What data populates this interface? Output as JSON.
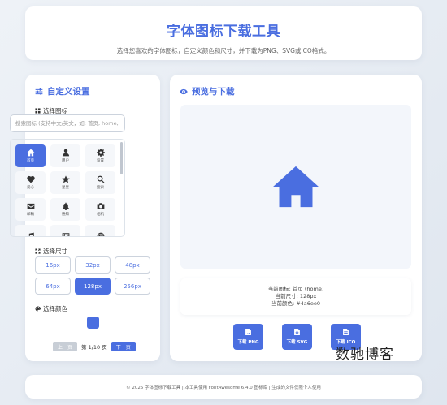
{
  "header": {
    "title": "字体图标下载工具",
    "subtitle": "选择您喜欢的字体图标，自定义颜色和尺寸，并下载为PNG、SVG或ICO格式。"
  },
  "settings": {
    "title": "自定义设置",
    "icon_section_label": "选择图标",
    "search_placeholder": "搜索图标 (支持中文/英文，如: 首页, home, us",
    "icons": [
      {
        "name": "home-icon",
        "label": "首页",
        "selected": true
      },
      {
        "name": "user-icon",
        "label": "用户",
        "selected": false
      },
      {
        "name": "gear-icon",
        "label": "设置",
        "selected": false
      },
      {
        "name": "heart-icon",
        "label": "爱心",
        "selected": false
      },
      {
        "name": "star-icon",
        "label": "星星",
        "selected": false
      },
      {
        "name": "search-icon",
        "label": "搜索",
        "selected": false
      },
      {
        "name": "envelope-icon",
        "label": "邮箱",
        "selected": false
      },
      {
        "name": "bell-icon",
        "label": "通知",
        "selected": false
      },
      {
        "name": "camera-icon",
        "label": "相机",
        "selected": false
      },
      {
        "name": "music-icon",
        "label": "",
        "selected": false
      },
      {
        "name": "film-icon",
        "label": "",
        "selected": false
      },
      {
        "name": "globe-icon",
        "label": "",
        "selected": false
      }
    ],
    "size_section_label": "选择尺寸",
    "sizes": [
      "16px",
      "32px",
      "48px",
      "64px",
      "128px",
      "256px"
    ],
    "selected_size": "128px",
    "color_section_label": "选择颜色",
    "selected_color": "#4a6ee0",
    "pager": {
      "prev": "上一页",
      "page_text": "第 1/10 页",
      "next": "下一页"
    }
  },
  "preview": {
    "title": "预览与下载",
    "info_icon": "当前图标: 首页 (home)",
    "info_size": "当前尺寸: 128px",
    "info_color": "当前颜色: #4a6ee0",
    "buttons": {
      "png": "下载 PNG",
      "svg": "下载 SVG",
      "ico": "下载 ICO"
    }
  },
  "footer": {
    "text": "© 2025 字体图标下载工具 | 本工具使用 FontAwesome 6.4.0 图标库 | 生成的文件仅限个人使用"
  },
  "watermark": "数驰博客",
  "colors": {
    "accent": "#4a6ee0",
    "background": "#e6ebf2"
  }
}
